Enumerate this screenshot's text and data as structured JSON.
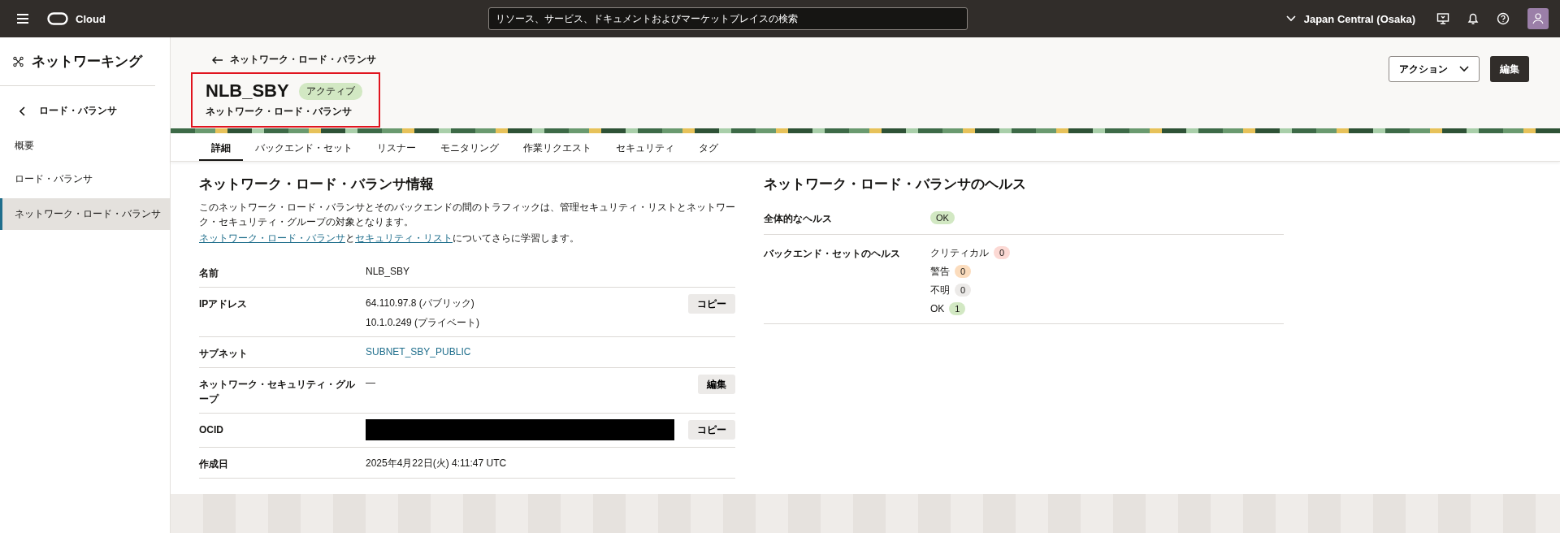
{
  "header": {
    "brand": "Cloud",
    "search": {
      "placeholder": "リソース、サービス、ドキュメントおよびマーケットプレイスの検索"
    },
    "region": "Japan Central (Osaka)"
  },
  "sidebar": {
    "title": "ネットワーキング",
    "back": "ロード・バランサ",
    "items": [
      {
        "label": "概要",
        "selected": false
      },
      {
        "label": "ロード・バランサ",
        "selected": false
      },
      {
        "label": "ネットワーク・ロード・バランサ",
        "selected": true
      }
    ]
  },
  "breadcrumb": "ネットワーク・ロード・バランサ",
  "resource": {
    "name": "NLB_SBY",
    "status": "アクティブ",
    "type": "ネットワーク・ロード・バランサ"
  },
  "actions": {
    "menu": "アクション",
    "edit": "編集"
  },
  "tabs": [
    {
      "label": "詳細",
      "selected": true
    },
    {
      "label": "バックエンド・セット",
      "selected": false
    },
    {
      "label": "リスナー",
      "selected": false
    },
    {
      "label": "モニタリング",
      "selected": false
    },
    {
      "label": "作業リクエスト",
      "selected": false
    },
    {
      "label": "セキュリティ",
      "selected": false
    },
    {
      "label": "タグ",
      "selected": false
    }
  ],
  "info": {
    "title": "ネットワーク・ロード・バランサ情報",
    "description": "このネットワーク・ロード・バランサとそのバックエンドの間のトラフィックは、管理セキュリティ・リストとネットワーク・セキュリティ・グループの対象となります。",
    "learn": {
      "link1": "ネットワーク・ロード・バランサ",
      "and": "と",
      "link2": "セキュリティ・リスト",
      "rest": "についてさらに学習します。"
    },
    "rows": [
      {
        "kind": "text",
        "label": "名前",
        "values": [
          "NLB_SBY"
        ]
      },
      {
        "kind": "text",
        "label": "IPアドレス",
        "values": [
          "64.110.97.8 (パブリック)",
          "10.1.0.249 (プライベート)"
        ],
        "button": "コピー"
      },
      {
        "kind": "link",
        "label": "サブネット",
        "values": [
          "SUBNET_SBY_PUBLIC"
        ]
      },
      {
        "kind": "text",
        "label": "ネットワーク・セキュリティ・グループ",
        "values": [
          "—"
        ],
        "button": "編集"
      },
      {
        "kind": "redacted",
        "label": "OCID",
        "button": "コピー"
      },
      {
        "kind": "text",
        "label": "作成日",
        "values": [
          "2025年4月22日(火) 4:11:47 UTC"
        ]
      }
    ]
  },
  "health": {
    "title": "ネットワーク・ロード・バランサのヘルス",
    "overall_label": "全体的なヘルス",
    "overall": "OK",
    "backend_label": "バックエンド・セットのヘルス",
    "backend": [
      {
        "label": "クリティカル",
        "count": "0",
        "color": "#fcd9d4"
      },
      {
        "label": "警告",
        "count": "0",
        "color": "#fbdcbd"
      },
      {
        "label": "不明",
        "count": "0",
        "color": "#eceae8"
      },
      {
        "label": "OK",
        "count": "1",
        "color": "#d2e8c3"
      }
    ]
  }
}
